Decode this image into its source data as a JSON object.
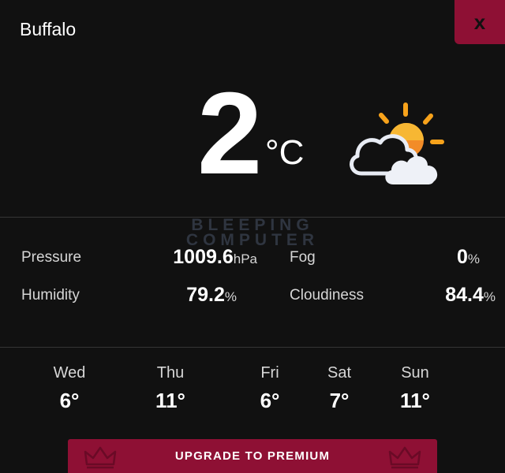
{
  "header": {
    "city": "Buffalo",
    "close_label": "x"
  },
  "current": {
    "temperature": "2",
    "unit": "°C",
    "icon": "partly-cloudy-sun-icon"
  },
  "watermark": {
    "line1": "BLEEPING",
    "line2": "COMPUTER"
  },
  "stats": {
    "pressure": {
      "label": "Pressure",
      "value": "1009.6",
      "unit": "hPa"
    },
    "fog": {
      "label": "Fog",
      "value": "0",
      "unit": "%"
    },
    "humidity": {
      "label": "Humidity",
      "value": "79.2",
      "unit": "%"
    },
    "cloudiness": {
      "label": "Cloudiness",
      "value": "84.4",
      "unit": "%"
    }
  },
  "forecast": [
    {
      "day": "Wed",
      "temp": "6°"
    },
    {
      "day": "Thu",
      "temp": "11°"
    },
    {
      "day": "Fri",
      "temp": "6°"
    },
    {
      "day": "Sat",
      "temp": "7°"
    },
    {
      "day": "Sun",
      "temp": "11°"
    }
  ],
  "upgrade": {
    "label": "UPGRADE TO PREMIUM"
  },
  "colors": {
    "background": "#111111",
    "accent": "#8e1034",
    "sun": "#f7a21b"
  }
}
